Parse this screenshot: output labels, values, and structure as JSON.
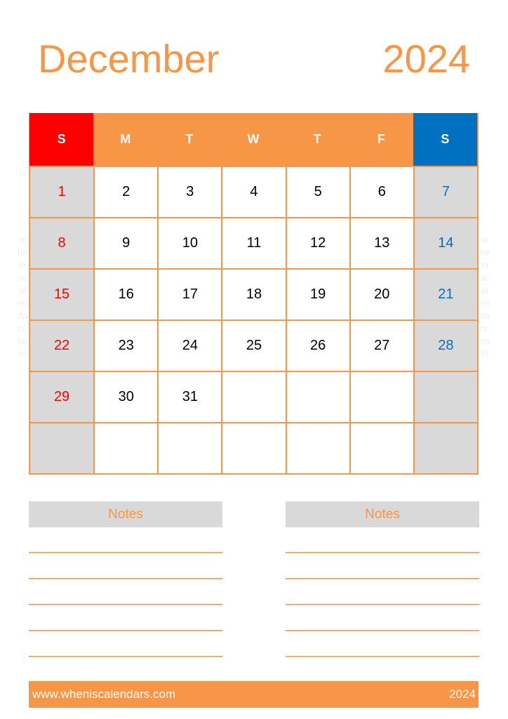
{
  "header": {
    "month": "December",
    "year": "2024"
  },
  "calendar": {
    "weekdays": [
      "S",
      "M",
      "T",
      "W",
      "T",
      "F",
      "S"
    ],
    "weeks": [
      [
        "1",
        "2",
        "3",
        "4",
        "5",
        "6",
        "7"
      ],
      [
        "8",
        "9",
        "10",
        "11",
        "12",
        "13",
        "14"
      ],
      [
        "15",
        "16",
        "17",
        "18",
        "19",
        "20",
        "21"
      ],
      [
        "22",
        "23",
        "24",
        "25",
        "26",
        "27",
        "28"
      ],
      [
        "29",
        "30",
        "31",
        "",
        "",
        "",
        ""
      ],
      [
        "",
        "",
        "",
        "",
        "",
        "",
        ""
      ]
    ]
  },
  "colors": {
    "accent": "#F79646",
    "sunday": "#FF0000",
    "saturday": "#0070C0",
    "weekend_fill": "#D9D9D9"
  },
  "watermark": {
    "side_text": "wheniscalendars.com"
  },
  "notes": {
    "left_title": "Notes",
    "right_title": "Notes",
    "line_count": 5
  },
  "footer": {
    "website": "www.wheniscalendars.com",
    "year": "2024"
  }
}
